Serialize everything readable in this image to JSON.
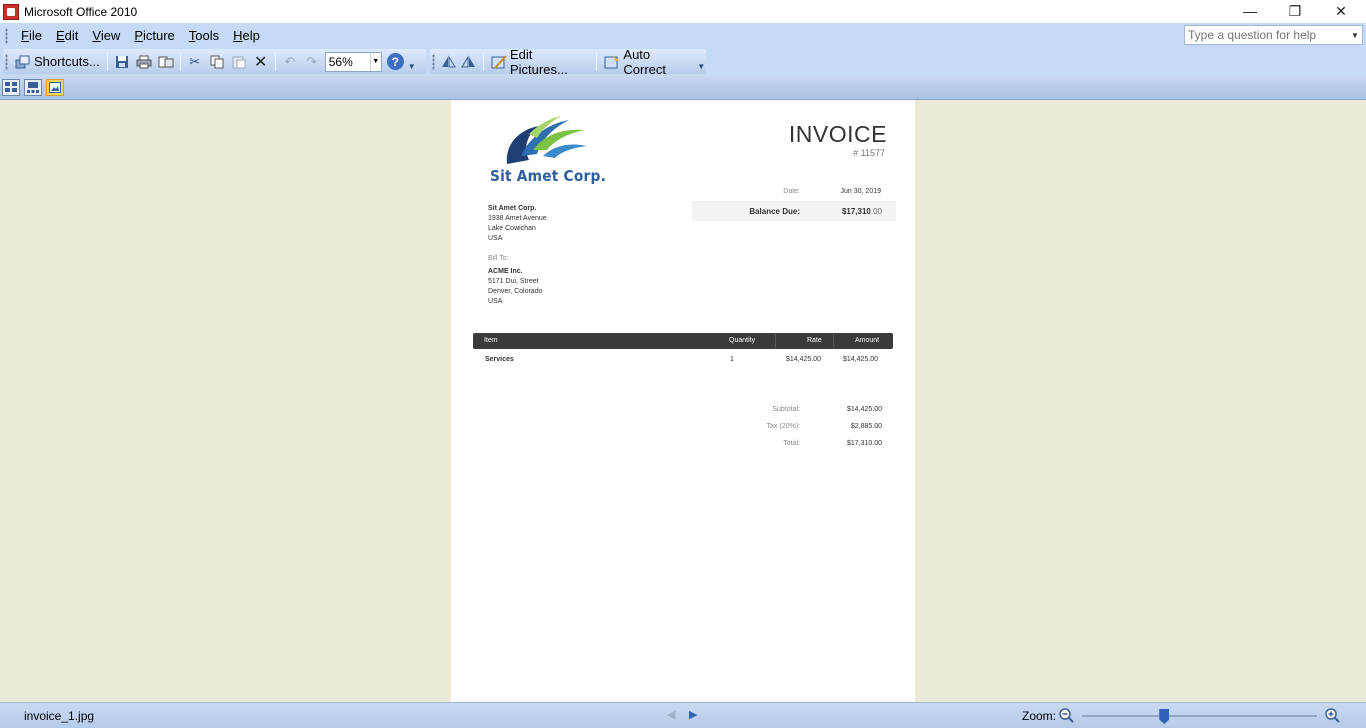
{
  "window": {
    "title": "Microsoft Office 2010",
    "minimize_glyph": "—",
    "maximize_glyph": "❐",
    "close_glyph": "✕"
  },
  "menu": {
    "items": [
      {
        "label": "File",
        "accel": "F"
      },
      {
        "label": "Edit",
        "accel": "E"
      },
      {
        "label": "View",
        "accel": "V"
      },
      {
        "label": "Picture",
        "accel": "P"
      },
      {
        "label": "Tools",
        "accel": "T"
      },
      {
        "label": "Help",
        "accel": "H"
      }
    ],
    "help_placeholder": "Type a question for help"
  },
  "toolbar": {
    "shortcuts_label": "Shortcuts...",
    "zoom_value": "56%",
    "help_glyph": "?",
    "edit_pictures_label": "Edit Pictures...",
    "auto_correct_label": "Auto Correct",
    "icons": [
      "shortcuts-icon",
      "save-icon",
      "print-icon",
      "send-icon",
      "cut-icon",
      "copy-icon",
      "paste-icon",
      "delete-icon",
      "undo-icon",
      "redo-icon",
      "help-icon",
      "rotate-left-icon",
      "rotate-right-icon",
      "edit-pictures-icon",
      "auto-correct-icon"
    ]
  },
  "invoice": {
    "company_logo_text": "Sit Amet Corp.",
    "title": "INVOICE",
    "number": "# 11577",
    "date_label": "Date:",
    "date_value": "Jun 30, 2019",
    "balance_label": "Balance Due:",
    "balance_main": "$17,310",
    "balance_cents": ".00",
    "from": {
      "name": "Sit Amet Corp.",
      "line1": "1938 Amet Avenue",
      "line2": "Lake Cowichan",
      "line3": "USA"
    },
    "bill_to_label": "Bill To:",
    "to": {
      "name": "ACME Inc.",
      "line1": "5171 Dui, Street",
      "line2": "Denver, Colorado",
      "line3": "USA"
    },
    "columns": {
      "item": "Item",
      "quantity": "Quantity",
      "rate": "Rate",
      "amount": "Amount"
    },
    "rows": [
      {
        "item": "Services",
        "quantity": "1",
        "rate": "$14,425.00",
        "amount": "$14,425.00"
      }
    ],
    "subtotal_label": "Subtotal:",
    "subtotal_value": "$14,425.00",
    "tax_label": "Tax (20%):",
    "tax_value": "$2,885.00",
    "total_label": "Total:",
    "total_value": "$17,310.00"
  },
  "status": {
    "filename": "invoice_1.jpg",
    "zoom_label": "Zoom:",
    "zoom_level": 0.35,
    "prev_glyph": "◀",
    "next_glyph": "▶"
  },
  "colors": {
    "menu_bg": "#c4daf5",
    "doc_bg": "#ece9d8",
    "accent_blue": "#2e62b8",
    "logo_blue": "#2f5e9e",
    "logo_green": "#7cc242"
  }
}
